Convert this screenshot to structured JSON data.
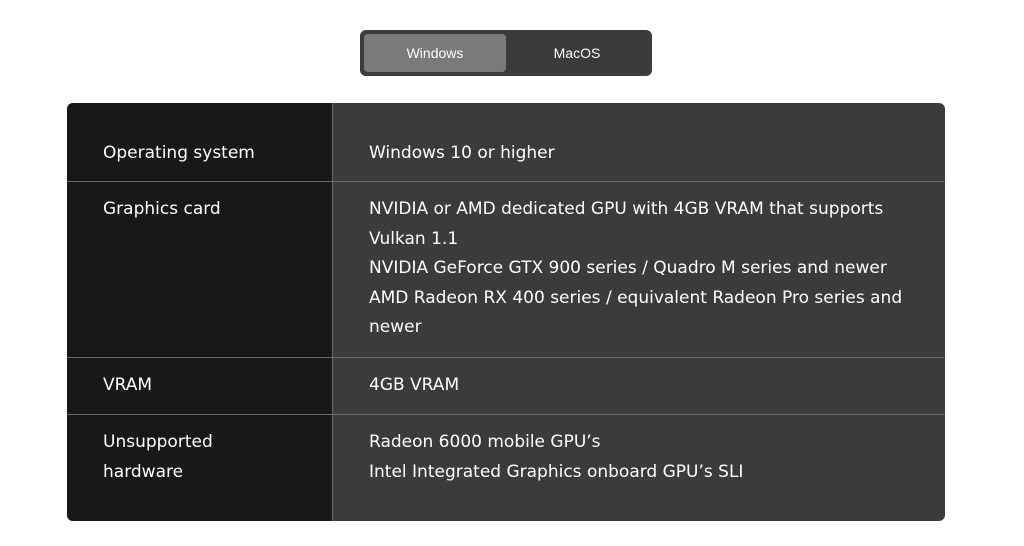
{
  "os_toggle": {
    "tabs": [
      {
        "label": "Windows",
        "active": true
      },
      {
        "label": "MacOS",
        "active": false
      }
    ]
  },
  "requirements": [
    {
      "label": "Operating system",
      "lines": [
        "Windows 10 or higher"
      ]
    },
    {
      "label": "Graphics card",
      "lines": [
        "NVIDIA or AMD dedicated GPU with 4GB VRAM that supports Vulkan 1.1",
        "NVIDIA GeForce GTX 900 series / Quadro M series and newer",
        "AMD Radeon RX 400 series / equivalent Radeon Pro series and newer"
      ]
    },
    {
      "label": "VRAM",
      "lines": [
        "4GB VRAM"
      ]
    },
    {
      "label": "Unsupported hardware",
      "lines": [
        "Radeon 6000 mobile GPU’s",
        "Intel Integrated Graphics onboard GPU’s SLI"
      ]
    }
  ],
  "colors": {
    "toggle_bg": "#3b3b3b",
    "toggle_active": "#7a7a7a",
    "label_col_bg": "#181818",
    "value_col_bg": "#3b3b3b",
    "divider": "#6a6a6a",
    "text": "#ffffff"
  }
}
